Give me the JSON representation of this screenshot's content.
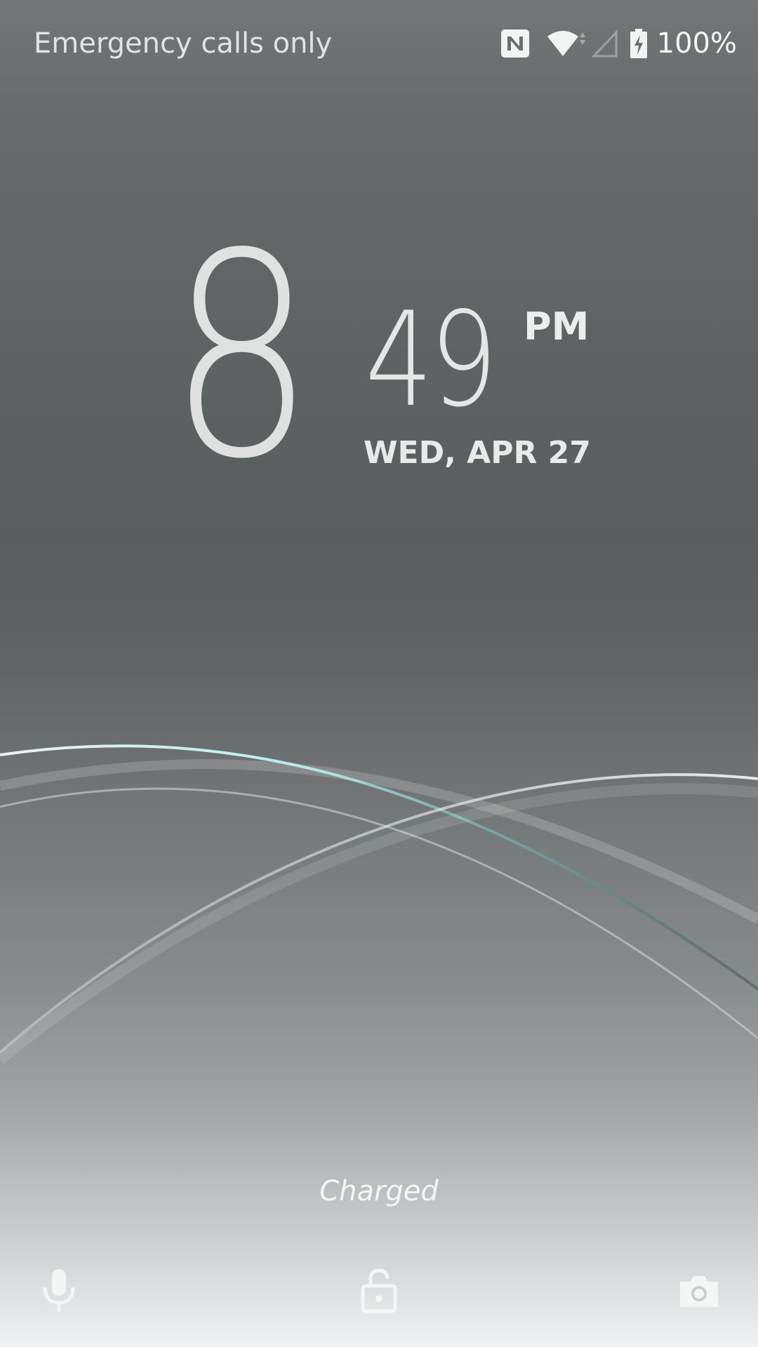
{
  "status_bar": {
    "carrier_text": "Emergency calls only",
    "battery_percent": "100%",
    "icons": [
      "nfc-icon",
      "wifi-icon",
      "cell-signal-icon",
      "battery-charging-icon"
    ]
  },
  "clock": {
    "hour": "8",
    "minute": "49",
    "ampm": "PM",
    "date": "WED, APR 27"
  },
  "charge_status": "Charged",
  "bottom_actions": [
    {
      "icon": "microphone-icon"
    },
    {
      "icon": "lock-icon"
    },
    {
      "icon": "camera-icon"
    }
  ],
  "colors": {
    "wallpaper_top": "#6d7171",
    "wallpaper_mid": "#5a5e5f",
    "wallpaper_bottom": "#eef2f2",
    "accent_swoosh": "#9ef0ec"
  }
}
